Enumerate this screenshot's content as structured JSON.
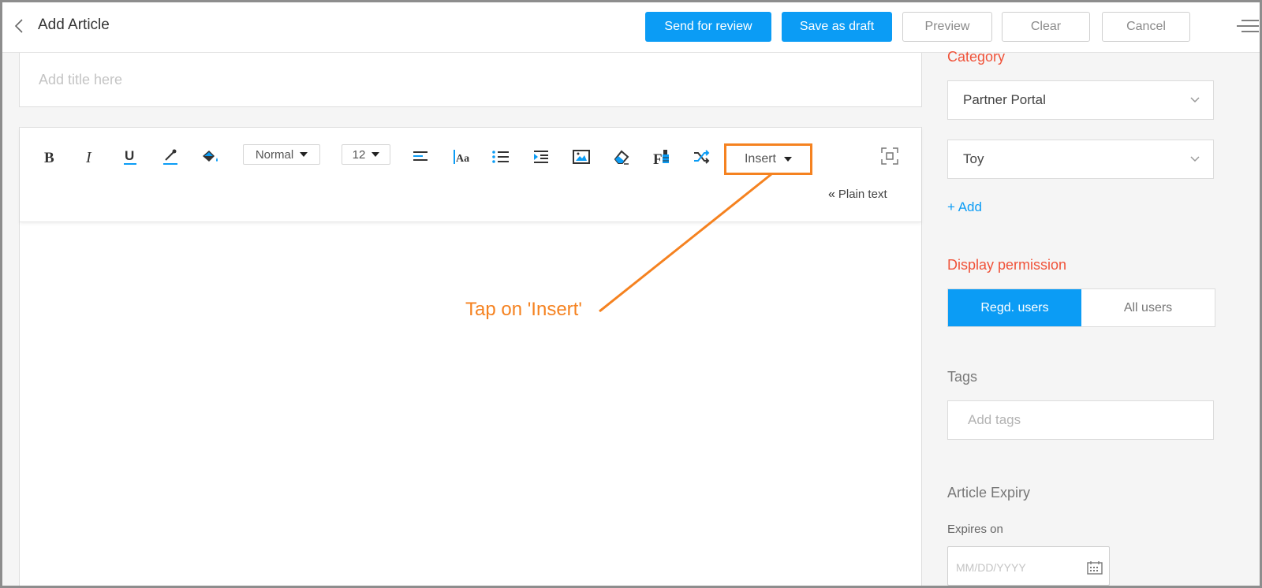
{
  "header": {
    "title": "Add Article",
    "buttons": {
      "send_for_review": "Send for review",
      "save_as_draft": "Save as draft",
      "preview": "Preview",
      "clear": "Clear",
      "cancel": "Cancel"
    }
  },
  "editor": {
    "title_placeholder": "Add title here",
    "toolbar": {
      "paragraph_format": "Normal",
      "font_size": "12",
      "insert_label": "Insert",
      "plain_text_label": "Plain text",
      "icons": [
        "bold-icon",
        "italic-icon",
        "underline-icon",
        "text-color-icon",
        "background-color-icon",
        "align-left-icon",
        "font-family-icon",
        "bullet-list-icon",
        "indent-icon",
        "image-icon",
        "eraser-icon",
        "font-format-icon",
        "shuffle-icon",
        "fullscreen-icon"
      ]
    }
  },
  "annotation": {
    "text": "Tap on 'Insert'",
    "color": "#f58220"
  },
  "sidebar": {
    "category_label": "Category",
    "category_value": "Partner Portal",
    "subcategory_value": "Toy",
    "add_label": "+ Add",
    "display_permission_label": "Display permission",
    "permission_options": [
      "Regd. users",
      "All users"
    ],
    "permission_selected": "Regd. users",
    "tags_label": "Tags",
    "tags_placeholder": "Add tags",
    "article_expiry_label": "Article Expiry",
    "expires_on_label": "Expires on",
    "date_placeholder": "MM/DD/YYYY"
  },
  "colors": {
    "primary": "#0b9cf5",
    "accent_red": "#f0533a",
    "annotation_orange": "#f58220"
  }
}
